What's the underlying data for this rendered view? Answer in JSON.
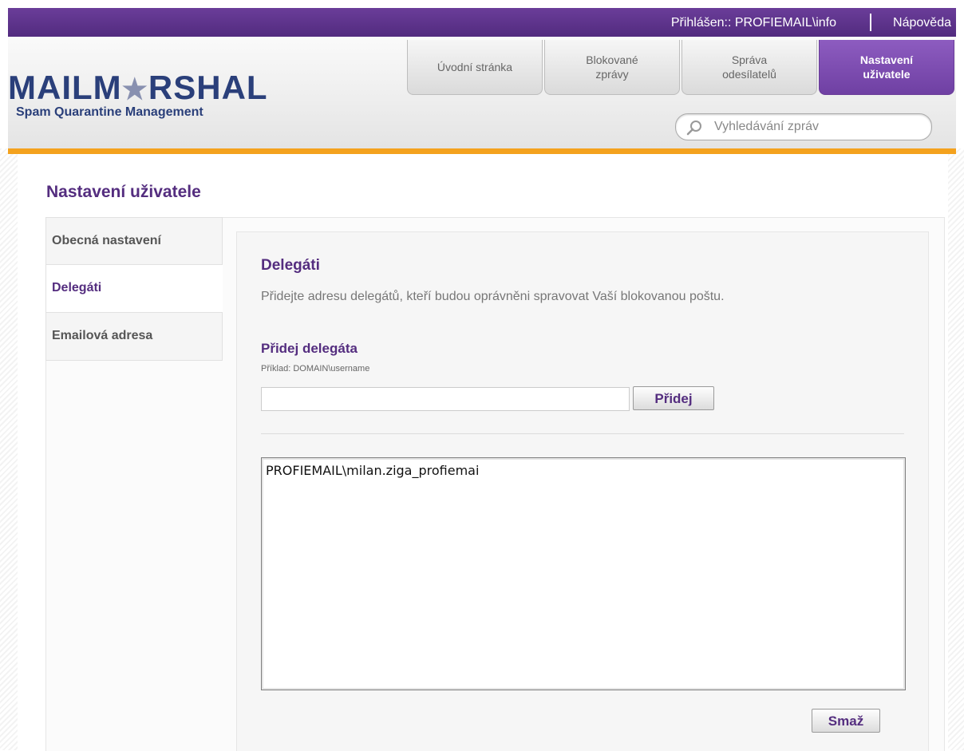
{
  "topbar": {
    "login_text": "Přihlášen:: PROFIEMAIL\\info",
    "help_link": "Nápověda"
  },
  "logo": {
    "title_part1": "MAILM",
    "title_star": "★",
    "title_part2": "RSHAL",
    "subtitle": "Spam Quarantine Management"
  },
  "nav": {
    "tabs": [
      {
        "label": "Úvodní stránka"
      },
      {
        "label": "Blokované zprávy"
      },
      {
        "label": "Správa odesílatelů"
      },
      {
        "label": "Nastavení uživatele"
      }
    ],
    "active_index": 3
  },
  "search": {
    "placeholder": "Vyhledávání zpráv",
    "icon": "search-icon"
  },
  "page": {
    "title": "Nastavení uživatele"
  },
  "side_menu": {
    "items": [
      {
        "label": "Obecná nastavení"
      },
      {
        "label": "Delegáti"
      },
      {
        "label": "Emailová adresa"
      }
    ],
    "active_index": 1
  },
  "delegates": {
    "title": "Delegáti",
    "description": "Přidejte adresu delegátů, kteří budou oprávněni spravovat Vaší blokovanou poštu.",
    "add_title": "Přidej delegáta",
    "add_example": "Příklad: DOMAIN\\username",
    "add_input_value": "",
    "add_button": "Přidej",
    "list": [
      "PROFIEMAIL\\milan.ziga_profiemai"
    ],
    "delete_button": "Smaž"
  },
  "colors": {
    "brand_purple": "#542d7f",
    "accent_orange": "#f4a21e",
    "logo_blue": "#2a3f7a"
  }
}
